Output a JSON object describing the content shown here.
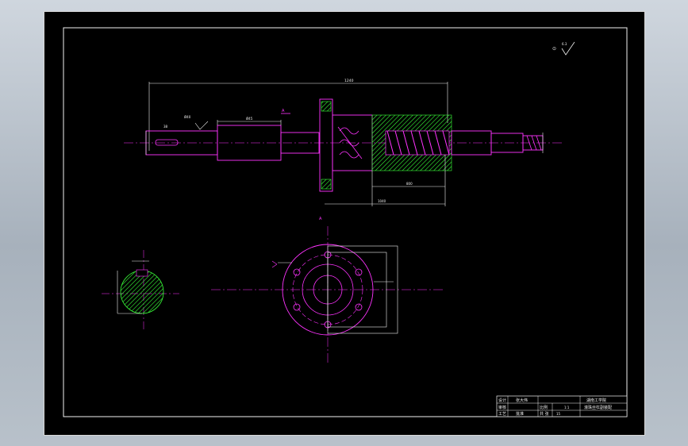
{
  "drawing": {
    "roughness_mark": "6.3",
    "section_label_top": "A",
    "section_label_bottom": "A",
    "dim_overall": "1240",
    "dim_left_a": "38",
    "dim_left_b": "Ø40",
    "dim_left_c": "Ø45",
    "dim_right_a": "800",
    "dim_right_b": "1040"
  },
  "title_block": {
    "role_designer": "设计",
    "role_checker": "审核",
    "role_process": "工艺",
    "role_approver": "批准",
    "designer_name": "张大伟",
    "school": "湖南工学院",
    "part_name": "滚珠丝杠副装配",
    "scale_label": "比例",
    "scale_value": "1:1",
    "sheet_label": "共 张",
    "sheet_value": "15"
  },
  "colors": {
    "sheet": "#000000",
    "frame": "#f2f2f2",
    "outline": "#ff33ff",
    "centerline": "#ff33ff",
    "hatch": "#39ff39",
    "hidden": "#ffffff"
  }
}
